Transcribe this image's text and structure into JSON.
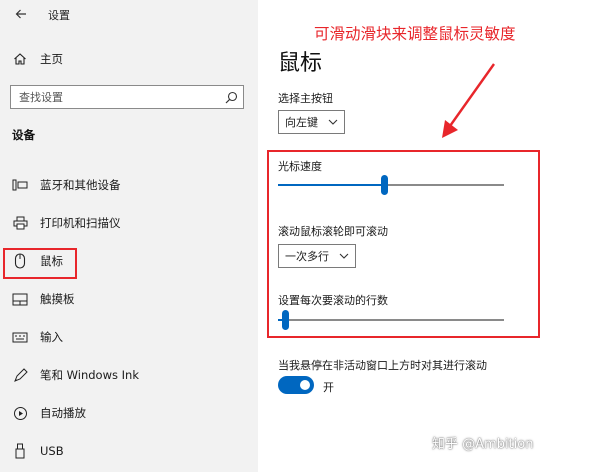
{
  "window": {
    "title": "设置"
  },
  "sidebar": {
    "home_label": "主页",
    "search_placeholder": "查找设置",
    "section_heading": "设备",
    "items": [
      {
        "label": "蓝牙和其他设备",
        "icon": "bluetooth-devices-icon"
      },
      {
        "label": "打印机和扫描仪",
        "icon": "printer-icon"
      },
      {
        "label": "鼠标",
        "icon": "mouse-icon",
        "selected": true
      },
      {
        "label": "触摸板",
        "icon": "touchpad-icon"
      },
      {
        "label": "输入",
        "icon": "keyboard-icon"
      },
      {
        "label": "笔和 Windows Ink",
        "icon": "pen-icon"
      },
      {
        "label": "自动播放",
        "icon": "autoplay-icon"
      },
      {
        "label": "USB",
        "icon": "usb-icon"
      }
    ]
  },
  "main": {
    "title": "鼠标",
    "primary_button": {
      "label": "选择主按钮",
      "value": "向左键"
    },
    "cursor_speed": {
      "label": "光标速度",
      "value_fraction": 0.47
    },
    "wheel_scroll": {
      "label": "滚动鼠标滚轮即可滚动",
      "value": "一次多行"
    },
    "lines_per_scroll": {
      "label": "设置每次要滚动的行数",
      "value_fraction": 0.03
    },
    "inactive_scroll": {
      "label": "当我悬停在非活动窗口上方时对其进行滚动",
      "toggle_state": "开",
      "on": true
    }
  },
  "annotation": {
    "text": "可滑动滑块来调整鼠标灵敏度"
  },
  "watermark": "知乎 @Ambition",
  "colors": {
    "accent": "#0067c0",
    "highlight": "#e8262b",
    "sidebar_bg": "#f2f2f2"
  }
}
